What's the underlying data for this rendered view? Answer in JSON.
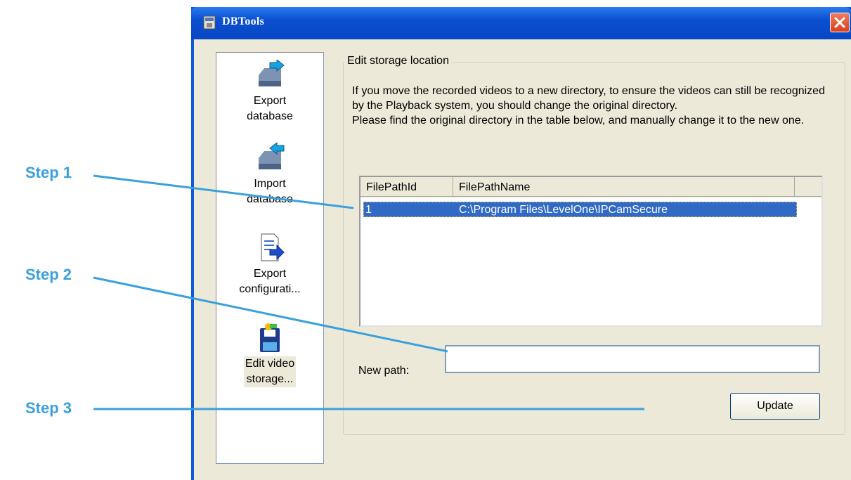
{
  "window": {
    "title": "DBTools"
  },
  "tools": [
    {
      "label": "Export\ndatabase",
      "icon": "export-database-icon"
    },
    {
      "label": "Import\ndatabase",
      "icon": "import-database-icon"
    },
    {
      "label": "Export\nconfigurati...",
      "icon": "export-configuration-icon"
    },
    {
      "label": "Edit video\nstorage...",
      "icon": "edit-video-storage-icon"
    }
  ],
  "group": {
    "title": "Edit storage location",
    "description": "If you move the recorded videos to a new directory, to ensure the videos can still be recognized by the Playback system, you should change the original directory.\nPlease find the original directory in the table below, and manually change it to the new one."
  },
  "table": {
    "headers": [
      "FilePathId",
      "FilePathName"
    ],
    "rows": [
      {
        "id": "1",
        "path": "C:\\Program Files\\LevelOne\\IPCamSecure"
      }
    ]
  },
  "new_path": {
    "label": "New path:",
    "value": ""
  },
  "update_button": "Update",
  "steps": [
    "Step 1",
    "Step 2",
    "Step 3"
  ],
  "colors": {
    "step": "#3aa0dc",
    "selection": "#316ac5",
    "titlebar": "#0a4fd0"
  }
}
